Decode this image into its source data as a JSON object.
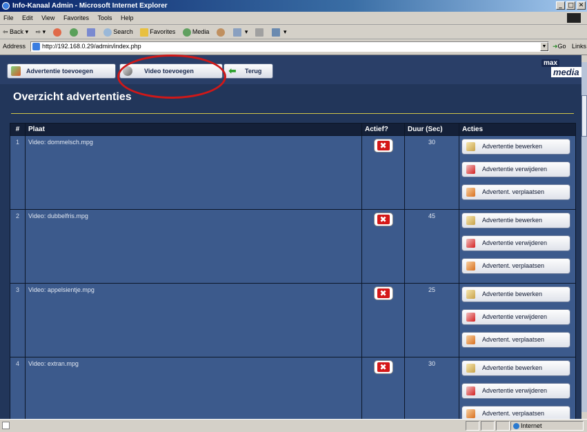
{
  "window": {
    "title": "Info-Kanaal Admin - Microsoft Internet Explorer",
    "controls": [
      "_",
      "□",
      "✕"
    ]
  },
  "menu": [
    "File",
    "Edit",
    "View",
    "Favorites",
    "Tools",
    "Help"
  ],
  "toolbar": [
    {
      "label": "⇦ Back",
      "icon": "back-icon"
    },
    {
      "label": "⇨",
      "icon": "forward-icon"
    },
    {
      "label": "",
      "icon": "stop-icon"
    },
    {
      "label": "",
      "icon": "refresh-icon"
    },
    {
      "label": "",
      "icon": "home-icon"
    },
    {
      "label": "Search",
      "icon": "search-icon"
    },
    {
      "label": "Favorites",
      "icon": "favorites-icon"
    },
    {
      "label": "Media",
      "icon": "media-icon"
    },
    {
      "label": "",
      "icon": "history-icon"
    },
    {
      "label": "",
      "icon": "mail-icon"
    },
    {
      "label": "",
      "icon": "print-icon"
    },
    {
      "label": "",
      "icon": "edit-icon"
    }
  ],
  "address": {
    "label": "Address",
    "url": "http://192.168.0.29/admin/index.php",
    "go": "Go",
    "links": "Links"
  },
  "nav": {
    "add_ad": "Advertentie toevoegen",
    "add_video": "Video toevoegen",
    "back": "Terug"
  },
  "logo": {
    "line1": "max",
    "line2": "media"
  },
  "page_title": "Overzicht advertenties",
  "table": {
    "headers": {
      "num": "#",
      "place": "Plaat",
      "active": "Actief?",
      "duration": "Duur (Sec)",
      "actions": "Acties"
    },
    "rows": [
      {
        "num": "1",
        "place": "Video: dommelsch.mpg",
        "active_icon": "inactive-x-icon",
        "duration": "30"
      },
      {
        "num": "2",
        "place": "Video: dubbelfris.mpg",
        "active_icon": "inactive-x-icon",
        "duration": "45"
      },
      {
        "num": "3",
        "place": "Video: appelsientje.mpg",
        "active_icon": "inactive-x-icon",
        "duration": "25"
      },
      {
        "num": "4",
        "place": "Video: extran.mpg",
        "active_icon": "inactive-x-icon",
        "duration": "30"
      }
    ],
    "actions": {
      "edit": "Advertentie bewerken",
      "delete": "Advertentie verwijderen",
      "move": "Advertent. verplaatsen"
    }
  },
  "status": {
    "zone": "Internet"
  },
  "colors": {
    "page_bg": "#22365a",
    "row_bg": "#3c5a8c",
    "header_bg": "#142038",
    "rule": "#d0c64a",
    "highlight": "#d01818"
  }
}
